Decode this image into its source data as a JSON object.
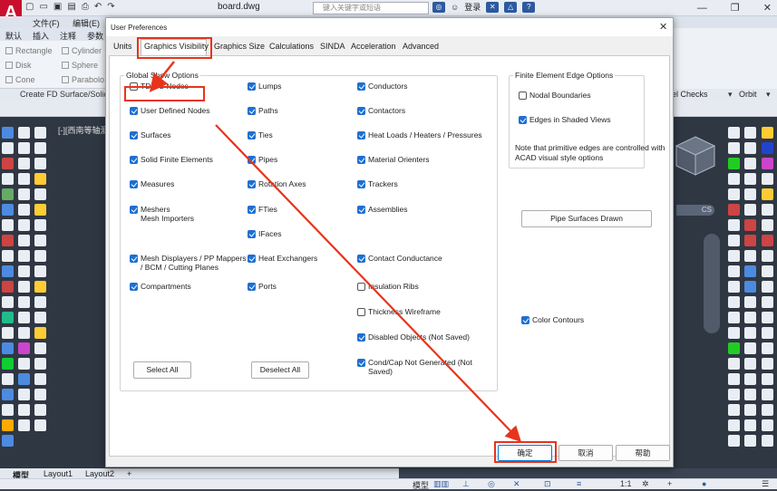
{
  "app": {
    "title": "board.dwg",
    "logo": "A",
    "search_placeholder": "键入关键字或短语",
    "signin": "登录",
    "menus": [
      "文件(F)",
      "编辑(E)"
    ],
    "ribbon_tabs": [
      "默认",
      "插入",
      "注释",
      "参数"
    ],
    "ribbon_items": [
      "Rectangle",
      "Cylinder",
      "Disk",
      "Sphere",
      "Cone",
      "Parabolo"
    ],
    "create_panel": "Create FD Surface/Solid",
    "el_checks": "el Checks",
    "orbit": "Orbit",
    "viewport_label": "[-][西南等轴测",
    "wcs": "CS",
    "layout_tabs": [
      "模型",
      "Layout1",
      "Layout2",
      "+"
    ],
    "status_model": "模型",
    "status_scale": "1:1"
  },
  "dialog": {
    "title": "User Preferences",
    "close": "✕",
    "tabs": [
      "Units",
      "Graphics Visibility",
      "Graphics Size",
      "Calculations",
      "SINDA",
      "Acceleration",
      "Advanced"
    ],
    "active_tab": "Graphics Visibility",
    "global_label": "Global Show Options",
    "fe_label": "Finite Element Edge Options",
    "global_options": [
      {
        "label": "TD/RC Nodes",
        "checked": false
      },
      {
        "label": "Lumps",
        "checked": true
      },
      {
        "label": "Conductors",
        "checked": true
      },
      {
        "label": "User Defined Nodes",
        "checked": true
      },
      {
        "label": "Paths",
        "checked": true
      },
      {
        "label": "Contactors",
        "checked": true
      },
      {
        "label": "Surfaces",
        "checked": true
      },
      {
        "label": "Ties",
        "checked": true
      },
      {
        "label": "Heat Loads / Heaters / Pressures",
        "checked": true
      },
      {
        "label": "Solid Finite Elements",
        "checked": true
      },
      {
        "label": "Pipes",
        "checked": true
      },
      {
        "label": "Material Orienters",
        "checked": true
      },
      {
        "label": "Measures",
        "checked": true
      },
      {
        "label": "Rotation Axes",
        "checked": true
      },
      {
        "label": "Trackers",
        "checked": true
      },
      {
        "label": "Meshers\nMesh Importers",
        "checked": true
      },
      {
        "label": "FTies",
        "checked": true
      },
      {
        "label": "Assemblies",
        "checked": true
      },
      {
        "label": "IFaces",
        "checked": true
      },
      {
        "label": "Mesh Displayers / PP Mappers\n/ BCM / Cutting Planes",
        "checked": true
      },
      {
        "label": "Heat Exchangers",
        "checked": true
      },
      {
        "label": "Contact Conductance",
        "checked": true
      },
      {
        "label": "Compartments",
        "checked": true
      },
      {
        "label": "Ports",
        "checked": true
      },
      {
        "label": "Insulation Ribs",
        "checked": false
      },
      {
        "label": "Thickness Wireframe",
        "checked": false
      },
      {
        "label": "Disabled Objects (Not Saved)",
        "checked": true
      },
      {
        "label": "Cond/Cap Not Generated (Not Saved)",
        "checked": true
      }
    ],
    "fe_options": [
      {
        "label": "Nodal Boundaries",
        "checked": false
      },
      {
        "label": "Edges in Shaded Views",
        "checked": true
      }
    ],
    "fe_note": "Note that primitive edges are controlled with ACAD visual style options",
    "pipe_surfaces_button": "Pipe Surfaces Drawn",
    "color_contours": {
      "label": "Color Contours",
      "checked": true
    },
    "select_all": "Select All",
    "deselect_all": "Deselect All",
    "ok": "确定",
    "cancel": "取消",
    "help": "帮助"
  },
  "annotation_color": "#e8341c"
}
